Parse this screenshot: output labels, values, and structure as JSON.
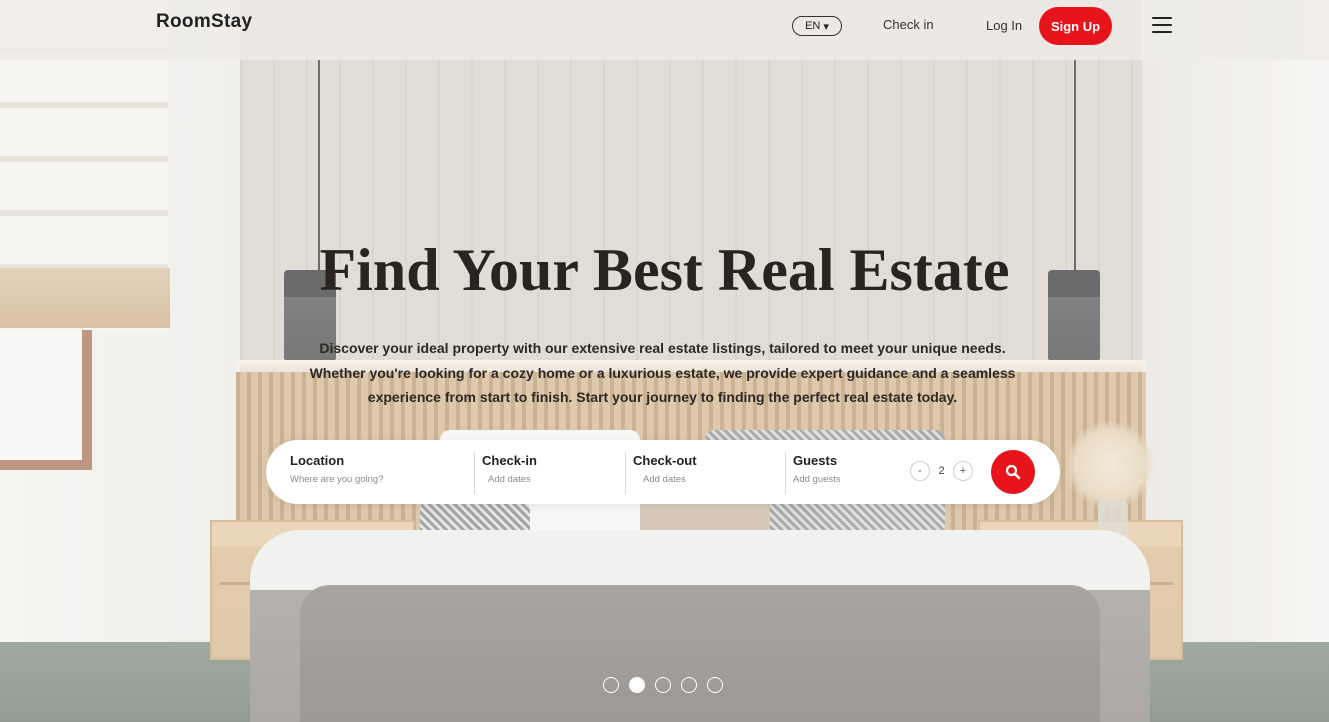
{
  "brand": {
    "name": "RoomStay"
  },
  "header": {
    "language": "EN",
    "language_caret": "▾",
    "check_in": "Check in",
    "log_in": "Log In",
    "sign_up": "Sign Up",
    "menu_icon": "hamburger-menu-icon"
  },
  "hero": {
    "title": "Find Your Best Real Estate",
    "description": "Discover your ideal property with our extensive real estate listings, tailored to meet your unique needs. Whether you're looking for a cozy home or a luxurious estate, we provide expert guidance and a seamless experience from start to finish. Start your journey to finding the perfect real estate today."
  },
  "search": {
    "location": {
      "label": "Location",
      "placeholder": "Where are you going?"
    },
    "check_in": {
      "label": "Check-in",
      "placeholder": "Add dates"
    },
    "check_out": {
      "label": "Check-out",
      "placeholder": "Add dates"
    },
    "guests": {
      "label": "Guests",
      "placeholder": "Add guests",
      "count": "2",
      "minus": "-",
      "plus": "+"
    },
    "button_icon": "search-icon"
  },
  "carousel": {
    "slides": 5,
    "active_index": 1
  },
  "colors": {
    "accent": "#e8141c",
    "text": "#222222",
    "header_bg": "#eeece8"
  }
}
